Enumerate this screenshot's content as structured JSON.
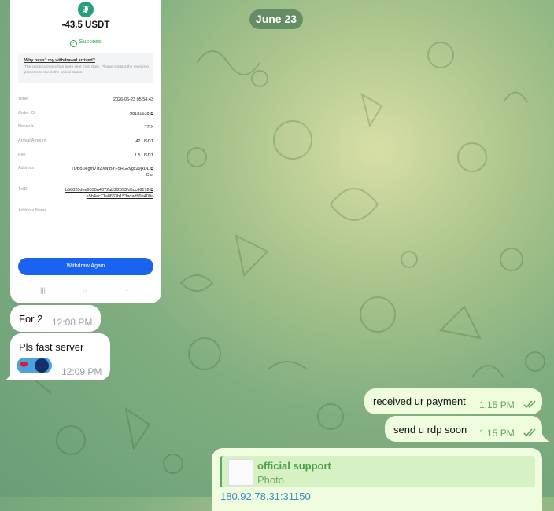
{
  "date_separator": "June 23",
  "screenshot": {
    "amount": "-43.5 USDT",
    "status": "Success",
    "help": {
      "title": "Why hasn't my withdrawal arrived?",
      "text": "The cryptocurrency has been sent from Gate. Please contact the receiving platform to check the arrival status."
    },
    "fields": {
      "time": {
        "label": "Time",
        "value": "2026-06-23 05:54:43"
      },
      "order_id": {
        "label": "Order ID",
        "value": "98181638"
      },
      "network": {
        "label": "Network",
        "value": "TRX"
      },
      "arrival_amount": {
        "label": "Arrival Amount",
        "value": "42 USDT"
      },
      "fee": {
        "label": "Fee",
        "value": "1.5 USDT"
      },
      "address": {
        "label": "Address",
        "value_line1": "TDBoDegmv7fZXNtBYF5HG2vgx29jxDL",
        "value_line2": "Ccx"
      },
      "txid": {
        "label": "TxID",
        "value_line1": "b58820dee9530a4072ab3f2893fd6cc66178",
        "value_line2": "e5b4ac71a8663b153adad99e400a"
      },
      "address_name": {
        "label": "Address Name",
        "value": "--"
      }
    },
    "button_label": "Withdraw Again"
  },
  "messages": [
    {
      "text": "For 2",
      "time": "12:08 PM",
      "direction": "in"
    },
    {
      "text": "Pls fast server",
      "time": "12:09 PM",
      "direction": "in",
      "reaction": "❤"
    },
    {
      "text": "received ur payment",
      "time": "1:15 PM",
      "direction": "out",
      "read": true
    },
    {
      "text": "send u rdp soon",
      "time": "1:15 PM",
      "direction": "out",
      "read": true
    }
  ],
  "reply": {
    "name": "official support",
    "subtitle": "Photo",
    "next_text": "180.92.78.31:31150"
  },
  "colors": {
    "outgoing_bubble": "#effdde",
    "incoming_bubble": "#ffffff",
    "accent_green": "#4c9e45",
    "button_blue": "#1a63f1"
  }
}
